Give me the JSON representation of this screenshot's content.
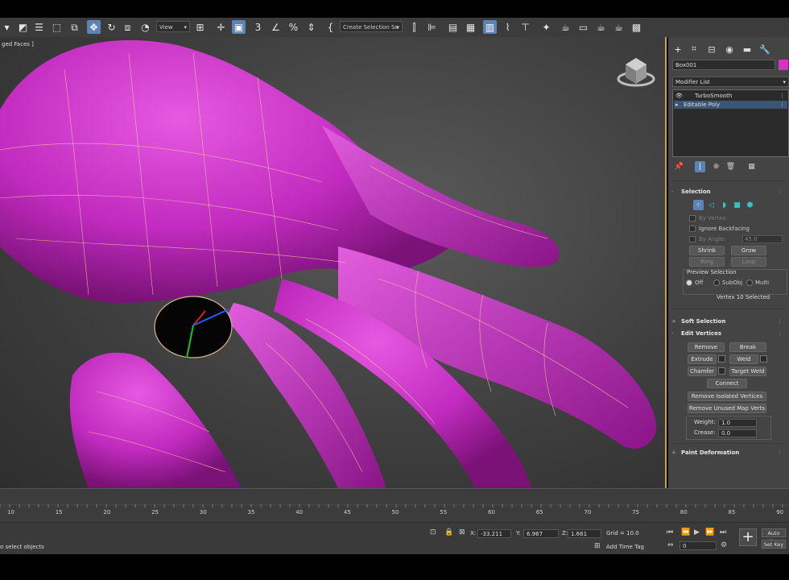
{
  "toolbar": {
    "view_dropdown": "View",
    "selection_set_dropdown": "Create Selection Se"
  },
  "viewport": {
    "label": "ged Faces ]"
  },
  "command_panel": {
    "object_name": "Box001",
    "object_color": "#d832c4",
    "modifier_list_label": "Modifier List",
    "stack": [
      {
        "name": "TurboSmooth"
      },
      {
        "name": "Editable Poly"
      }
    ],
    "selection": {
      "title": "Selection",
      "by_vertex": "By Vertex",
      "ignore_backfacing": "Ignore Backfacing",
      "by_angle": "By Angle:",
      "by_angle_value": "45.0",
      "shrink": "Shrink",
      "grow": "Grow",
      "ring": "Ring",
      "loop": "Loop",
      "preview_selection": "Preview Selection",
      "preview_options": [
        "Off",
        "SubObj",
        "Multi"
      ],
      "status": "Vertex 10 Selected"
    },
    "soft_selection": {
      "title": "Soft Selection"
    },
    "edit_vertices": {
      "title": "Edit Vertices",
      "remove": "Remove",
      "break": "Break",
      "extrude": "Extrude",
      "weld": "Weld",
      "chamfer": "Chamfer",
      "target_weld": "Target Weld",
      "connect": "Connect",
      "remove_isolated": "Remove Isolated Vertices",
      "remove_unused": "Remove Unused Map Verts",
      "weight_label": "Weight:",
      "weight_value": "1.0",
      "crease_label": "Crease:",
      "crease_value": "0.0"
    },
    "paint_deformation": {
      "title": "Paint Deformation"
    }
  },
  "timeline": {
    "ticks": [
      "10",
      "15",
      "20",
      "25",
      "30",
      "35",
      "40",
      "45",
      "50",
      "55",
      "60",
      "65",
      "70",
      "75",
      "80",
      "85",
      "90"
    ]
  },
  "status_bar": {
    "prompt": "o select objects",
    "x_label": "X:",
    "x_value": "-33.211",
    "y_label": "Y:",
    "y_value": "6.967",
    "z_label": "Z:",
    "z_value": "1.661",
    "grid": "Grid = 10.0",
    "add_time_tag": "Add Time Tag",
    "frame_value": "0",
    "auto_key": "Auto Key",
    "set_key": "Set Key"
  }
}
